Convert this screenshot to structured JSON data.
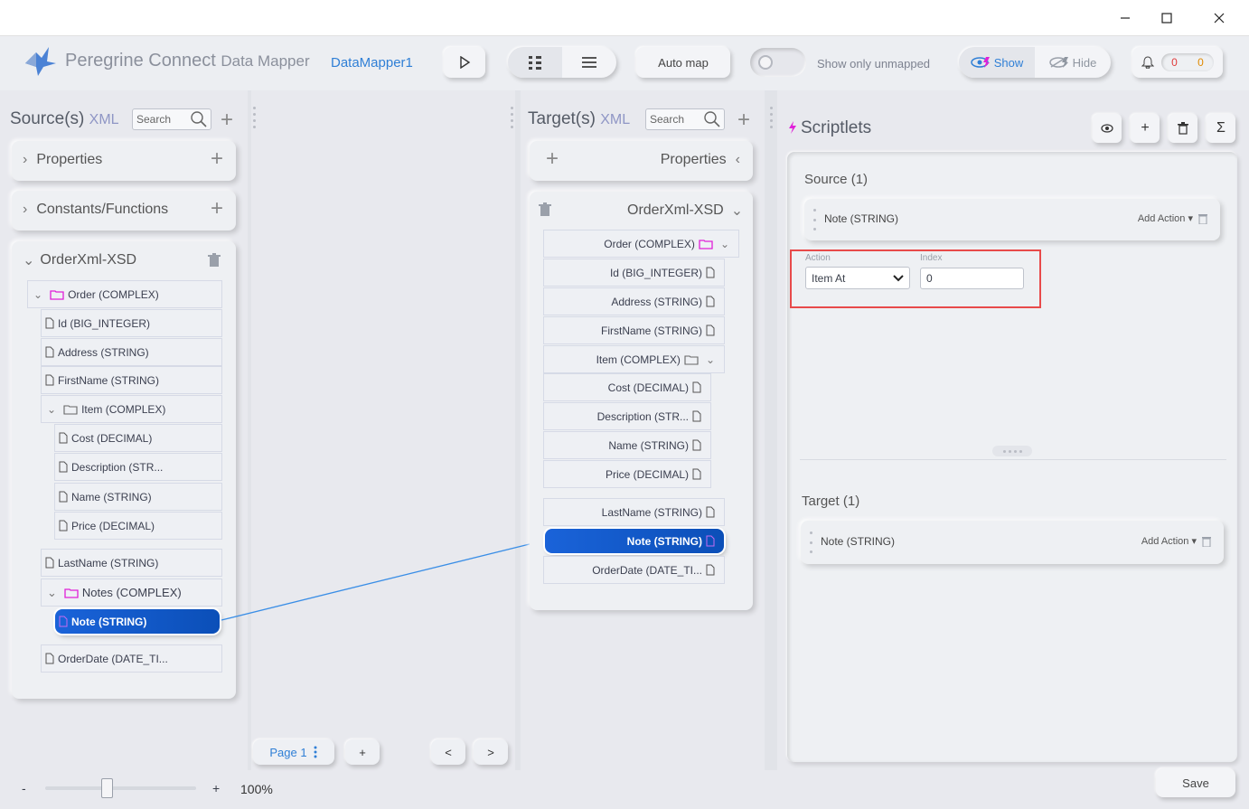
{
  "window": {
    "minimize": "—",
    "maximize": "☐",
    "close": "✕"
  },
  "toolbar": {
    "brand": "Peregrine Connect",
    "product": "Data Mapper",
    "mapper_name": "DataMapper1",
    "auto_map": "Auto map",
    "show_only_unmapped": "Show only unmapped",
    "show": "Show",
    "hide": "Hide",
    "notif_count_a": "0",
    "notif_count_b": "0"
  },
  "source": {
    "title": "Source(s)",
    "format": "XML",
    "search_placeholder": "Search",
    "properties": "Properties",
    "constants": "Constants/Functions",
    "doc_title": "OrderXml-XSD",
    "rows": {
      "order": "Order (COMPLEX)",
      "id": "Id (BIG_INTEGER)",
      "address": "Address (STRING)",
      "firstname": "FirstName (STRING)",
      "item": "Item (COMPLEX)",
      "cost": "Cost (DECIMAL)",
      "description": "Description (STR...",
      "name": "Name (STRING)",
      "price": "Price (DECIMAL)",
      "lastname": "LastName (STRING)",
      "notes": "Notes (COMPLEX)",
      "note": "Note (STRING)",
      "orderdate": "OrderDate (DATE_TI..."
    }
  },
  "target": {
    "title": "Target(s)",
    "format": "XML",
    "search_placeholder": "Search",
    "properties": "Properties",
    "doc_title": "OrderXml-XSD",
    "rows": {
      "order": "Order (COMPLEX)",
      "id": "Id (BIG_INTEGER)",
      "address": "Address (STRING)",
      "firstname": "FirstName (STRING)",
      "item": "Item (COMPLEX)",
      "cost": "Cost (DECIMAL)",
      "description": "Description (STR...",
      "name": "Name (STRING)",
      "price": "Price (DECIMAL)",
      "lastname": "LastName (STRING)",
      "note": "Note (STRING)",
      "orderdate": "OrderDate (DATE_TI..."
    }
  },
  "scriptlets": {
    "title": "Scriptlets",
    "source_header": "Source (1)",
    "source_field": "Note (STRING)",
    "add_action": "Add Action",
    "action_label": "Action",
    "action_value": "Item At",
    "index_label": "Index",
    "index_value": "0",
    "target_header": "Target (1)",
    "target_field": "Note (STRING)",
    "sigma": "Σ"
  },
  "pager": {
    "page": "Page 1",
    "add": "+",
    "prev": "<",
    "next": ">"
  },
  "footer": {
    "minus": "-",
    "plus": "+",
    "zoom": "100%",
    "zoom_level": 0.41,
    "save": "Save"
  },
  "colors": {
    "accent": "#2f7fd6",
    "selected": "#1a63d9",
    "highlight_box": "#e84a4a",
    "complex_folder": "#e020d8",
    "notif_red": "#e03a3a",
    "notif_orange": "#e08a00"
  }
}
